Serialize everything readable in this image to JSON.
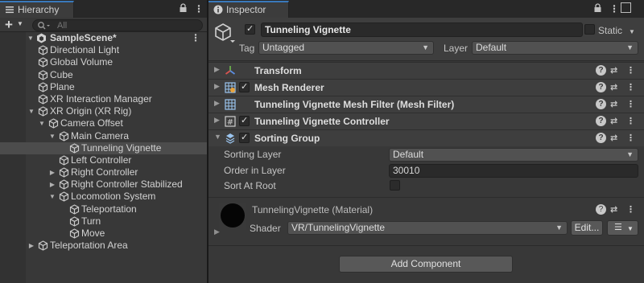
{
  "hierarchy": {
    "tab_label": "Hierarchy",
    "search_placeholder": "All",
    "add_label": "+",
    "scene": "SampleScene*",
    "items": [
      {
        "label": "Directional Light"
      },
      {
        "label": "Global Volume"
      },
      {
        "label": "Cube"
      },
      {
        "label": "Plane"
      },
      {
        "label": "XR Interaction Manager"
      },
      {
        "label": "XR Origin (XR Rig)"
      },
      {
        "label": "Camera Offset"
      },
      {
        "label": "Main Camera"
      },
      {
        "label": "Tunneling Vignette"
      },
      {
        "label": "Left Controller"
      },
      {
        "label": "Right Controller"
      },
      {
        "label": "Right Controller Stabilized"
      },
      {
        "label": "Locomotion System"
      },
      {
        "label": "Teleportation"
      },
      {
        "label": "Turn"
      },
      {
        "label": "Move"
      },
      {
        "label": "Teleportation Area"
      }
    ]
  },
  "inspector": {
    "tab_label": "Inspector",
    "object_name": "Tunneling Vignette",
    "static_label": "Static",
    "tag_label": "Tag",
    "tag_value": "Untagged",
    "layer_label": "Layer",
    "layer_value": "Default",
    "components": [
      {
        "title": "Transform"
      },
      {
        "title": "Mesh Renderer"
      },
      {
        "title": "Tunneling Vignette Mesh Filter (Mesh Filter)"
      },
      {
        "title": "Tunneling Vignette Controller"
      },
      {
        "title": "Sorting Group"
      }
    ],
    "sorting_group": {
      "sorting_layer_label": "Sorting Layer",
      "sorting_layer_value": "Default",
      "order_label": "Order in Layer",
      "order_value": "30010",
      "sort_at_root_label": "Sort At Root"
    },
    "material": {
      "title": "TunnelingVignette (Material)",
      "shader_label": "Shader",
      "shader_value": "VR/TunnelingVignette",
      "edit_label": "Edit..."
    },
    "add_component_label": "Add Component"
  },
  "colors": {
    "accent": "#3a79bb",
    "panel": "#383838",
    "header": "#3e3e3e",
    "selection": "#4c4c4c"
  }
}
